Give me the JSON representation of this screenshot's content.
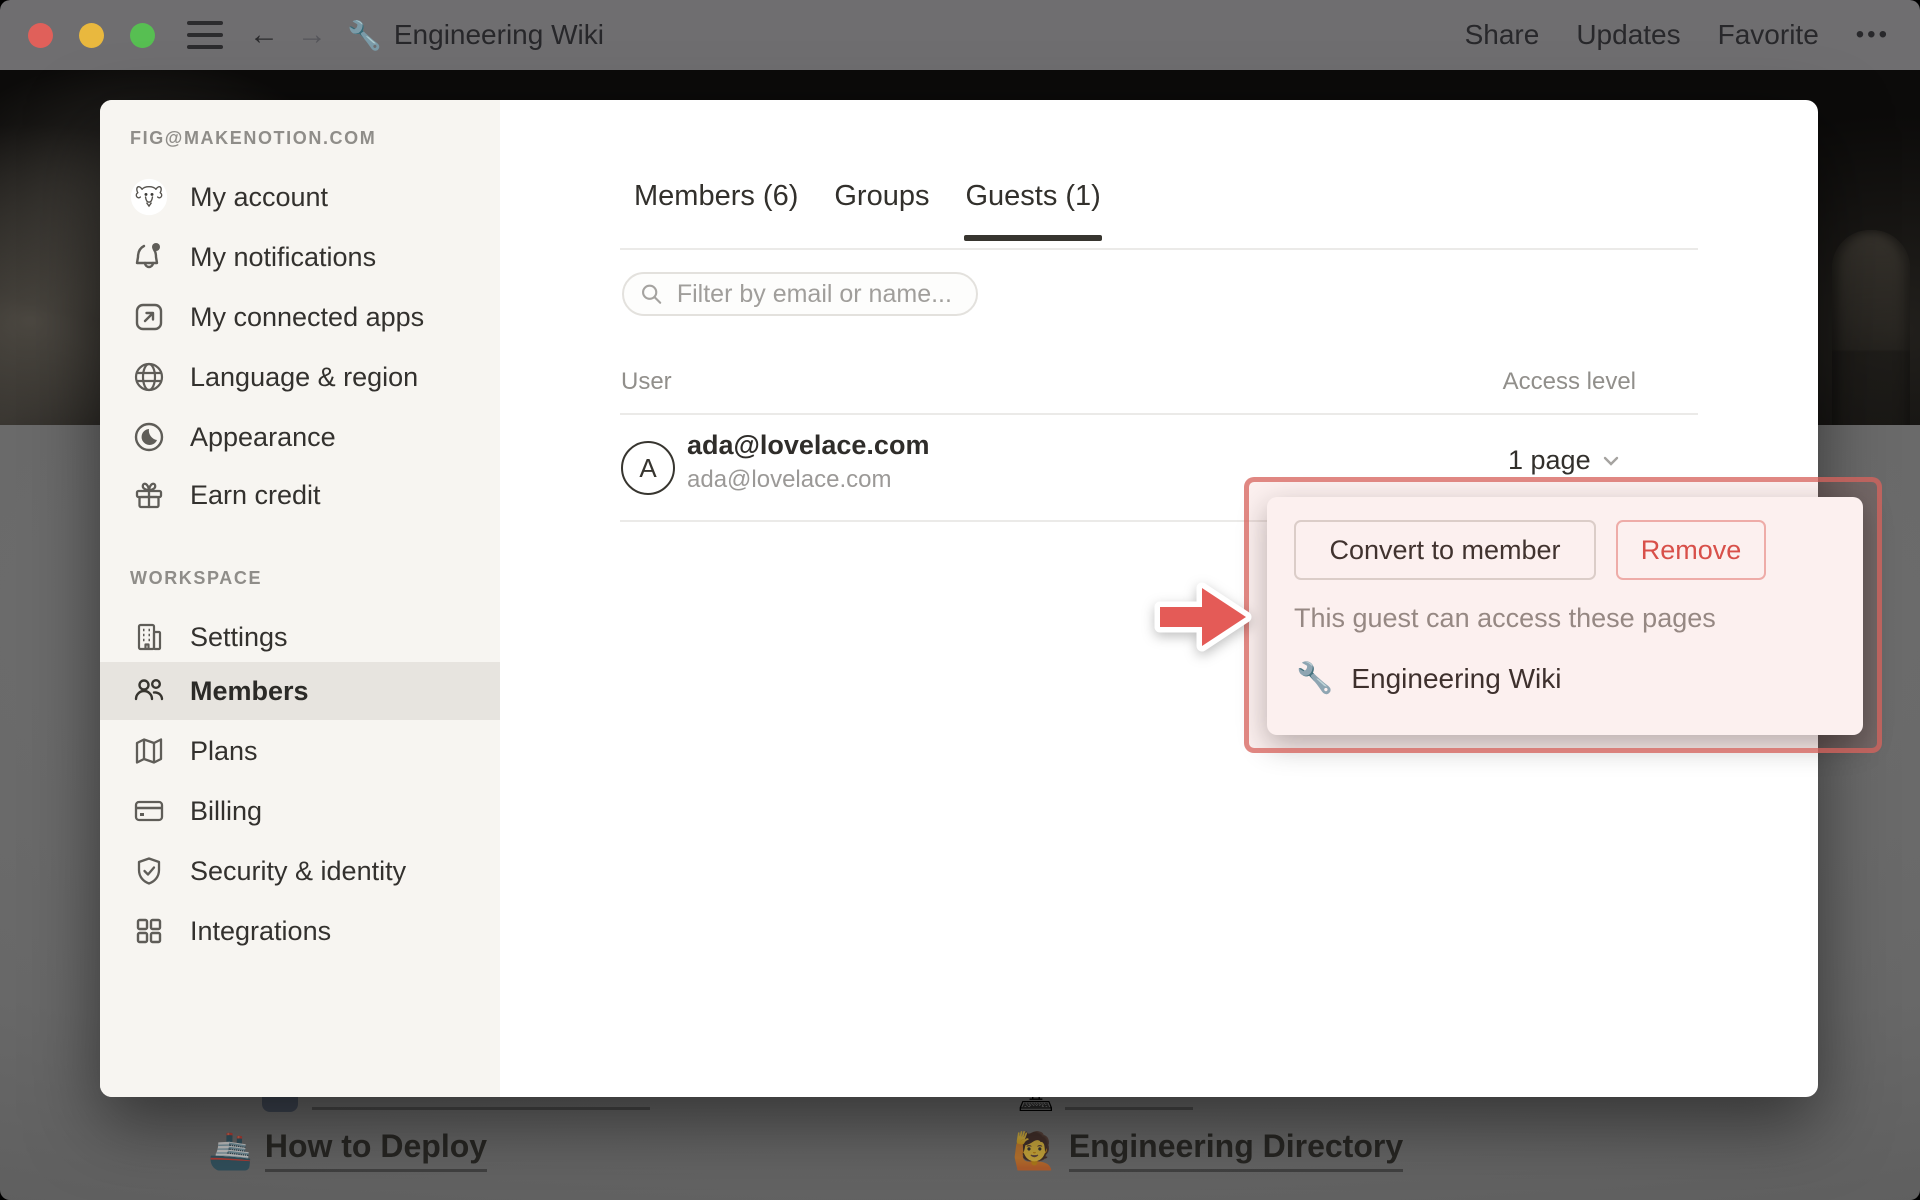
{
  "titlebar": {
    "title_icon": "🔧",
    "title": "Engineering Wiki",
    "share_label": "Share",
    "updates_label": "Updates",
    "favorite_label": "Favorite",
    "more_label": "•••"
  },
  "sidebar": {
    "account_section_label": "FIG@MAKENOTION.COM",
    "account_items": [
      {
        "icon": "avatar-doodle",
        "label": "My account"
      },
      {
        "icon": "bell",
        "label": "My notifications"
      },
      {
        "icon": "arrow-up-right-square",
        "label": "My connected apps"
      },
      {
        "icon": "globe",
        "label": "Language & region"
      },
      {
        "icon": "moon",
        "label": "Appearance"
      },
      {
        "icon": "gift",
        "label": "Earn credit"
      }
    ],
    "workspace_section_label": "WORKSPACE",
    "workspace_items": [
      {
        "icon": "building",
        "label": "Settings",
        "selected": false
      },
      {
        "icon": "people",
        "label": "Members",
        "selected": true
      },
      {
        "icon": "map",
        "label": "Plans",
        "selected": false
      },
      {
        "icon": "credit-card",
        "label": "Billing",
        "selected": false
      },
      {
        "icon": "shield-check",
        "label": "Security & identity",
        "selected": false
      },
      {
        "icon": "grid",
        "label": "Integrations",
        "selected": false
      }
    ]
  },
  "main": {
    "tabs": [
      {
        "label": "Members (6)",
        "active": false
      },
      {
        "label": "Groups",
        "active": false
      },
      {
        "label": "Guests (1)",
        "active": true
      }
    ],
    "search_placeholder": "Filter by email or name...",
    "table": {
      "col_user": "User",
      "col_access": "Access level",
      "row": {
        "avatar_letter": "A",
        "name": "ada@lovelace.com",
        "email": "ada@lovelace.com",
        "access_value": "1 page"
      }
    }
  },
  "popup": {
    "convert_label": "Convert to member",
    "remove_label": "Remove",
    "description": "This guest can access these pages",
    "page": {
      "icon": "🔧",
      "title": "Engineering Wiki"
    }
  },
  "background_page": {
    "cut_row_right_icon": "🖥",
    "link_left": {
      "icon": "🚢",
      "label": "How to Deploy"
    },
    "link_right": {
      "icon": "🙋",
      "label": "Engineering Directory"
    }
  },
  "colors": {
    "accent_red": "#d8504a",
    "highlight_border": "#d5635e",
    "selected_row_bg": "#e7e4df",
    "sidebar_bg": "#f7f5f1",
    "tab_underline": "#37352f"
  }
}
